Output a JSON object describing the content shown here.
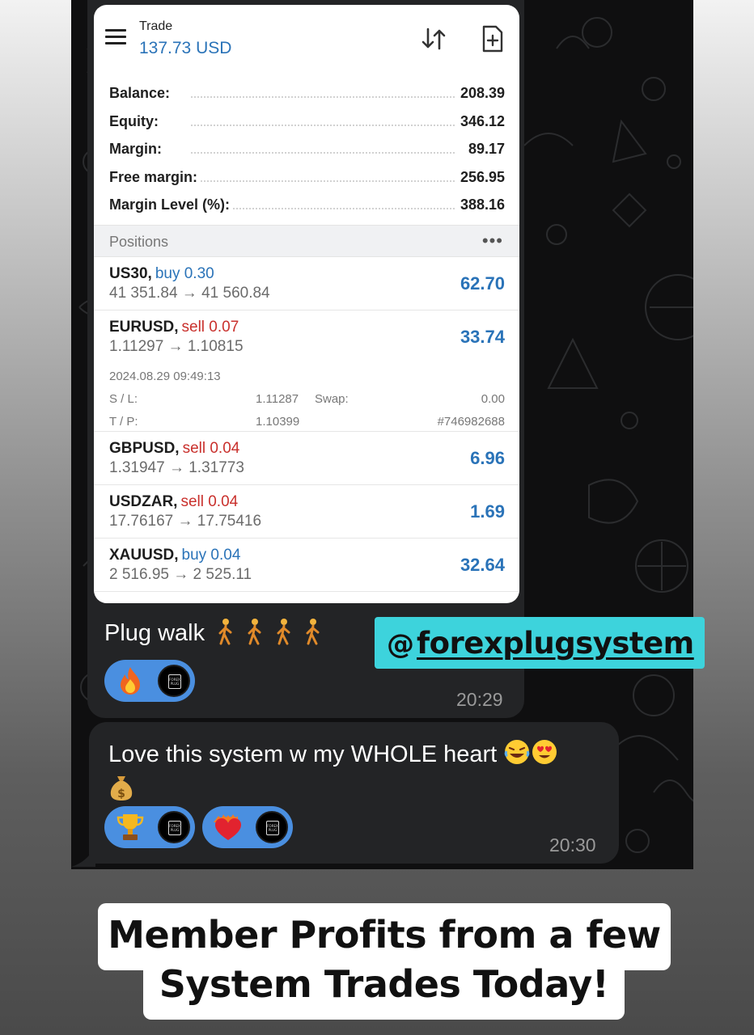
{
  "trade_screen": {
    "title": "Trade",
    "profit": "137.73 USD",
    "account": [
      {
        "label": "Balance:",
        "value": "208.39"
      },
      {
        "label": "Equity:",
        "value": "346.12"
      },
      {
        "label": "Margin:",
        "value": "89.17"
      },
      {
        "label": "Free margin:",
        "value": "256.95"
      },
      {
        "label": "Margin Level (%):",
        "value": "388.16"
      }
    ],
    "positions_header": "Positions",
    "more_label": "•••",
    "positions": [
      {
        "symbol": "US30,",
        "side": "buy 0.30",
        "prices": "41 351.84 → 41 560.84",
        "profit": "62.70"
      },
      {
        "symbol": "EURUSD,",
        "side": "sell 0.07",
        "prices": "1.11297 → 1.10815",
        "profit": "33.74"
      },
      {
        "symbol": "GBPUSD,",
        "side": "sell 0.04",
        "prices": "1.31947 → 1.31773",
        "profit": "6.96"
      },
      {
        "symbol": "USDZAR,",
        "side": "sell 0.04",
        "prices": "17.76167 → 17.75416",
        "profit": "1.69"
      },
      {
        "symbol": "XAUUSD,",
        "side": "buy 0.04",
        "prices": "2 516.95 → 2 525.11",
        "profit": "32.64"
      }
    ],
    "expanded": {
      "date": "2024.08.29 09:49:13",
      "sl_label": "S / L:",
      "sl_value": "1.11287",
      "swap_label": "Swap:",
      "swap_value": "0.00",
      "tp_label": "T / P:",
      "tp_value": "1.10399",
      "ticket": "#746982688"
    }
  },
  "messages": [
    {
      "text": "Plug walk",
      "time": "20:29",
      "reactions": [
        "fire"
      ]
    },
    {
      "text": "Love this system w my WHOLE heart",
      "time": "20:30",
      "reactions": [
        "trophy",
        "heart-on-fire"
      ]
    }
  ],
  "reaction_avatar_text": "FOREX PLUG",
  "handle": "forexplugsystem",
  "handle_at": "@",
  "headline": {
    "line1": "Member Profits from a few",
    "line2": "System Trades Today!"
  },
  "colors": {
    "buy": "#2a73b8",
    "sell": "#c9302c",
    "reaction_bg": "#4a8fe0",
    "handle_bg": "#3dd3dc",
    "chat_bg": "#0f0f10",
    "bubble_bg": "#232426"
  },
  "icons": [
    "menu-icon",
    "sort-icon",
    "new-order-icon",
    "walking-person-icon",
    "fire-icon",
    "trophy-icon",
    "heart-on-fire-icon",
    "laughing-face-icon",
    "heart-eyes-icon",
    "money-bag-icon",
    "threads-icon"
  ]
}
